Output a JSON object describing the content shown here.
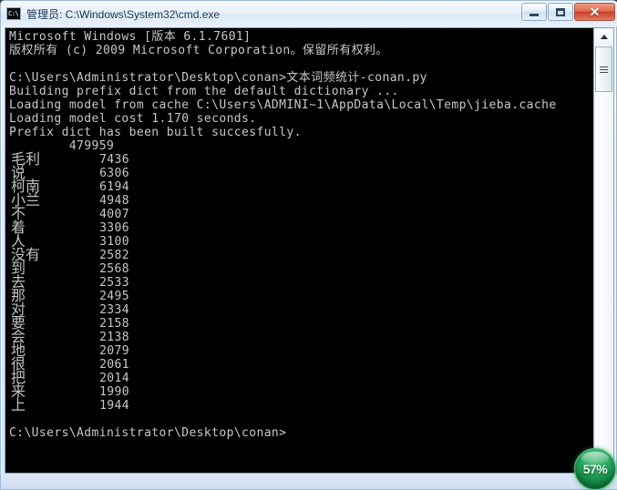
{
  "window": {
    "title": "管理员: C:\\Windows\\System32\\cmd.exe",
    "icon_name": "cmd-icon",
    "icon_label": "C:\\",
    "buttons": {
      "minimize": "Minimize",
      "restore": "Restore",
      "close": "✕"
    }
  },
  "console": {
    "header_lines": [
      "Microsoft Windows [版本 6.1.7601]",
      "版权所有 (c) 2009 Microsoft Corporation。保留所有权利。",
      "",
      "C:\\Users\\Administrator\\Desktop\\conan>文本词频统计-conan.py",
      "Building prefix dict from the default dictionary ...",
      "Loading model from cache C:\\Users\\ADMINI~1\\AppData\\Local\\Temp\\jieba.cache",
      "Loading model cost 1.170 seconds.",
      "Prefix dict has been built succesfully."
    ],
    "first_count": "479959",
    "word_counts": [
      {
        "word": "毛利",
        "count": "7436"
      },
      {
        "word": "说",
        "count": "6306"
      },
      {
        "word": "柯南",
        "count": "6194"
      },
      {
        "word": "小兰",
        "count": "4948"
      },
      {
        "word": "不",
        "count": "4007"
      },
      {
        "word": "着",
        "count": "3306"
      },
      {
        "word": "人",
        "count": "3100"
      },
      {
        "word": "没有",
        "count": "2582"
      },
      {
        "word": "到",
        "count": "2568"
      },
      {
        "word": "去",
        "count": "2533"
      },
      {
        "word": "那",
        "count": "2495"
      },
      {
        "word": "对",
        "count": "2334"
      },
      {
        "word": "要",
        "count": "2158"
      },
      {
        "word": "会",
        "count": "2138"
      },
      {
        "word": "地",
        "count": "2079"
      },
      {
        "word": "很",
        "count": "2061"
      },
      {
        "word": "把",
        "count": "2014"
      },
      {
        "word": "来",
        "count": "1990"
      },
      {
        "word": "上",
        "count": "1944"
      }
    ],
    "prompt_line": "C:\\Users\\Administrator\\Desktop\\conan>"
  },
  "scrollbar": {
    "up_arrow": "▲",
    "down_arrow": "▼"
  },
  "badge": {
    "text": "57%"
  }
}
